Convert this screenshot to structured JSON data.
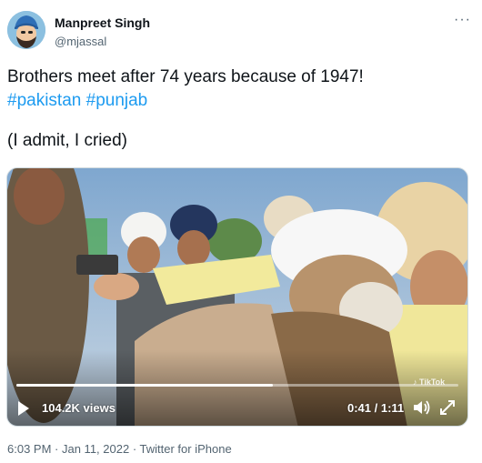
{
  "author": {
    "display_name": "Manpreet Singh",
    "handle": "@mjassal",
    "avatar_icon": "cartoon-avatar-icon"
  },
  "more_icon": "more-options-icon",
  "tweet": {
    "line1": "Brothers meet after 74 years because of 1947!",
    "hashtag1": "#pakistan",
    "hashtag2": "#punjab",
    "line3": "(I admit, I cried)"
  },
  "video": {
    "views": "104.2K views",
    "time": "0:41 / 1:11",
    "progress": 0.58,
    "play_icon": "play-icon",
    "volume_icon": "volume-icon",
    "expand_icon": "expand-icon"
  },
  "meta": {
    "time": "6:03 PM",
    "sep1": " · ",
    "date": "Jan 11, 2022",
    "sep2": " · ",
    "source": "Twitter for iPhone"
  },
  "colors": {
    "hashtag": "#1d9bf0",
    "text": "#0f1419",
    "secondary": "#536471"
  }
}
